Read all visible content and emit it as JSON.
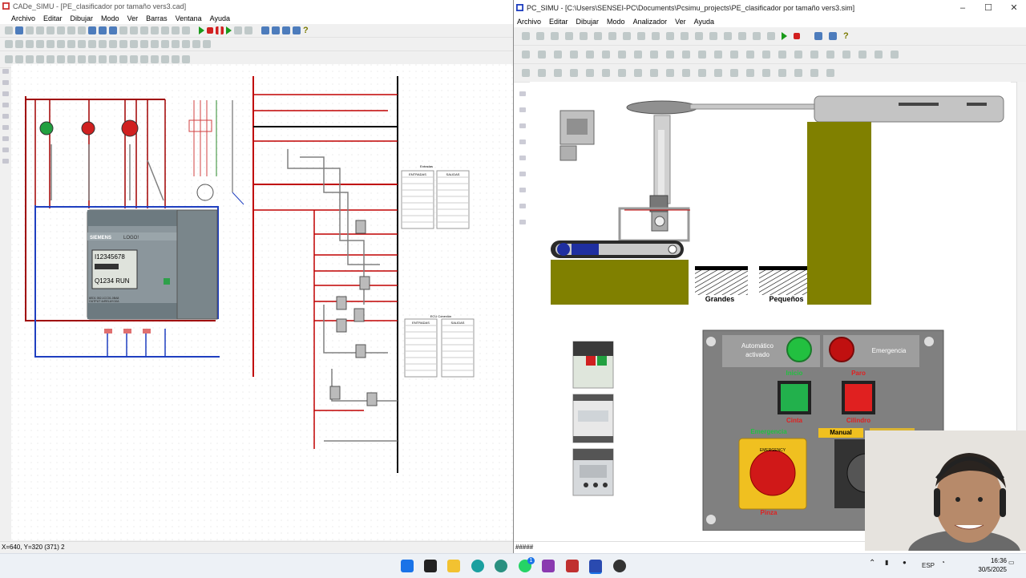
{
  "cade": {
    "title": "CADe_SIMU - [PE_clasificador por tamaño vers3.cad]",
    "menu": [
      "Archivo",
      "Editar",
      "Dibujar",
      "Modo",
      "Ver",
      "Barras",
      "Ventana",
      "Ayuda"
    ],
    "status": "X=640, Y=320 (371) 2",
    "plc": {
      "brand": "SIEMENS",
      "model": "LOGO!",
      "line1": "I12345678",
      "line2": "Q1234 RUN",
      "foot": "6ED1 052-1CC01-0BA8",
      "foot2": "OUTPUT 4xRELAY/10A"
    },
    "table1": {
      "caption": "Entradas",
      "col1": "ENTRADAS",
      "col2": "SALIDAS"
    },
    "table2": {
      "caption": "ECU Conexión",
      "col1": "ENTRADAS",
      "col2": "SALIDAS"
    }
  },
  "pcsimu": {
    "title": "PC_SIMU - [C:\\Users\\SENSEI-PC\\Documents\\Pcsimu_projects\\PE_clasificador por tamaño vers3.sim]",
    "menu": [
      "Archivo",
      "Editar",
      "Dibujar",
      "Modo",
      "Analizador",
      "Ver",
      "Ayuda"
    ],
    "status": "#####",
    "scene": {
      "label_big": "Grandes",
      "label_small": "Pequeños"
    },
    "hmi": {
      "auto_label": "Automático activado",
      "emergency_label": "Emergencia",
      "inicio": "Inicio",
      "paro": "Paro",
      "cinta": "Cinta",
      "cilindro": "Cilindro",
      "emergencia2": "Emergencia",
      "pinza": "Pinza",
      "manual": "Manual",
      "estop_text": "EMERGENCY"
    }
  },
  "taskbar": {
    "lang": "ESP",
    "time": "16:36",
    "date": "30/5/2025",
    "chat_badge": "1"
  },
  "colors": {
    "olive": "#808000",
    "wire_red": "#c00000",
    "wire_blue": "#1f3fc0",
    "hmi_panel": "#808080",
    "green_button": "#22b14c",
    "red_button": "#e02020"
  }
}
